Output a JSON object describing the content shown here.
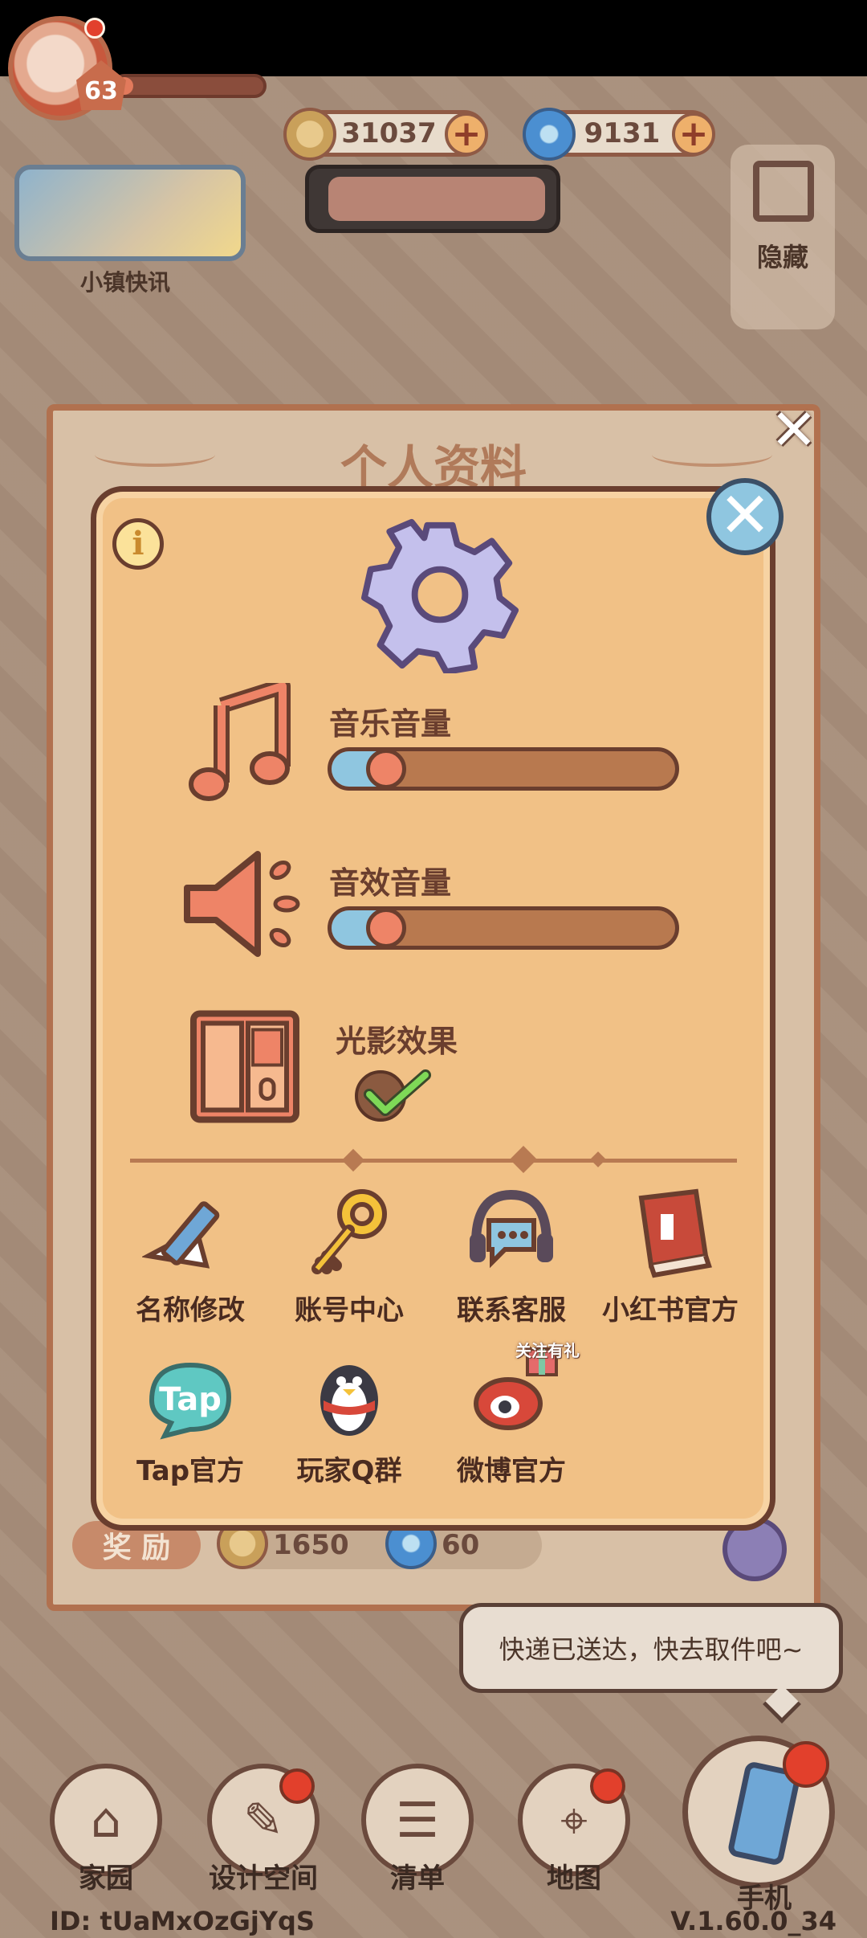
{
  "hud": {
    "level": "63",
    "level_progress": 0.12,
    "currencies": [
      {
        "name": "coin-icon",
        "value": "31037",
        "color": "#c9a05a"
      },
      {
        "name": "gem-icon",
        "value": "9131",
        "color": "#4b8fd1"
      }
    ],
    "news_label": "小镇快讯",
    "hide_label": "隐藏"
  },
  "background_panel": {
    "title": "个人资料",
    "reward_label": "奖 励",
    "rewards": [
      {
        "icon": "coin-icon",
        "value": "1650"
      },
      {
        "icon": "gem-icon",
        "value": "60"
      }
    ]
  },
  "settings_modal": {
    "music_label": "音乐音量",
    "music_volume": 0.1,
    "sfx_label": "音效音量",
    "sfx_volume": 0.1,
    "lighting_label": "光影效果",
    "lighting_enabled": true,
    "links": [
      {
        "icon": "pencil-icon",
        "label": "名称修改"
      },
      {
        "icon": "key-icon",
        "label": "账号中心"
      },
      {
        "icon": "headset-icon",
        "label": "联系客服"
      },
      {
        "icon": "red-book-icon",
        "label": "小红书官方"
      },
      {
        "icon": "tap-logo-icon",
        "label": "Tap官方"
      },
      {
        "icon": "penguin-icon",
        "label": "玩家Q群"
      },
      {
        "icon": "weibo-icon",
        "label": "微博官方",
        "badge": "关注有礼"
      }
    ]
  },
  "notification": {
    "text": "快递已送达，快去取件吧~"
  },
  "bottom_nav": [
    {
      "icon": "house-icon",
      "label": "家园"
    },
    {
      "icon": "ruler-icon",
      "label": "设计空间"
    },
    {
      "icon": "checklist-icon",
      "label": "清单"
    },
    {
      "icon": "map-pin-icon",
      "label": "地图"
    },
    {
      "icon": "phone-icon",
      "label": "手机"
    }
  ],
  "footer": {
    "player_id": "ID:  tUaMxOzGjYqS",
    "version": "V.1.60.0_34"
  },
  "colors": {
    "accent": "#f1c186",
    "border": "#6a3e2e",
    "slider": "#8fc6e0",
    "knob": "#ee8467"
  }
}
